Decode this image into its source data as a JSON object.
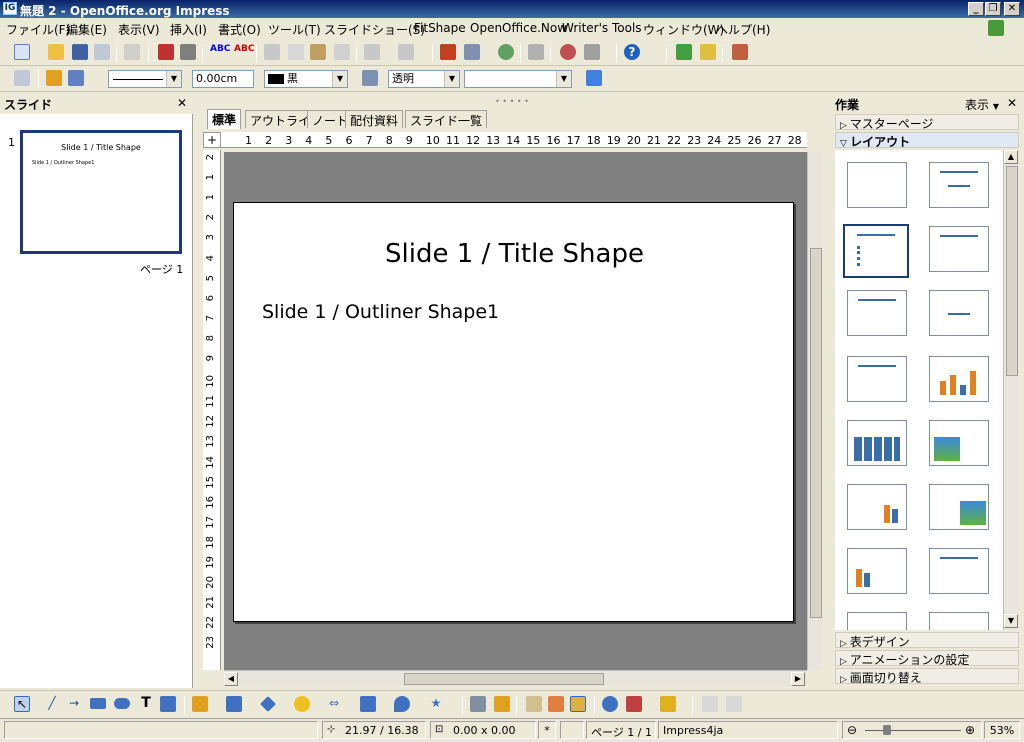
{
  "window": {
    "title": "無題 2 - OpenOffice.org Impress",
    "app_icon": "impress-icon"
  },
  "menubar": [
    "ファイル(F)",
    "編集(E)",
    "表示(V)",
    "挿入(I)",
    "書式(O)",
    "ツール(T)",
    "スライドショー(S)",
    "FitShape",
    "OpenOffice.Now",
    "Writer's Tools",
    "ウィンドウ(W)",
    "ヘルプ(H)"
  ],
  "format_bar": {
    "line_width": "0.00cm",
    "line_color": "黒",
    "area_style": "透明",
    "area_fill": ""
  },
  "slides_panel": {
    "title": "スライド",
    "thumbnail": {
      "number": "1",
      "title": "Slide 1 / Title Shape",
      "body": "Slide 1 / Outliner Shape1",
      "page_label": "ページ 1"
    }
  },
  "view_tabs": [
    "標準",
    "アウトライン",
    "ノート",
    "配付資料",
    "スライド一覧"
  ],
  "ruler": {
    "horizontal": [
      "1",
      "2",
      "3",
      "4",
      "5",
      "6",
      "7",
      "8",
      "9",
      "10",
      "11",
      "12",
      "13",
      "14",
      "15",
      "16",
      "17",
      "18",
      "19",
      "20",
      "21",
      "22",
      "23",
      "24",
      "25",
      "26",
      "27",
      "28"
    ],
    "vertical": [
      "2",
      "1",
      "1",
      "2",
      "3",
      "4",
      "5",
      "6",
      "7",
      "8",
      "9",
      "10",
      "11",
      "12",
      "13",
      "14",
      "15",
      "16",
      "17",
      "18",
      "19",
      "20",
      "21",
      "22",
      "23"
    ]
  },
  "slide": {
    "title": "Slide 1 / Title Shape",
    "body": "Slide 1 / Outliner Shape1"
  },
  "tasks_panel": {
    "title": "作業",
    "view_label": "表示",
    "sections": {
      "master": "マスターページ",
      "layout": "レイアウト",
      "table": "表デザイン",
      "animation": "アニメーションの設定",
      "transition": "画面切り替え"
    }
  },
  "statusbar": {
    "position": "21.97 / 16.38",
    "size": "0.00 x 0.00",
    "modified": "*",
    "page": "ページ 1 / 1",
    "master": "Impress4ja",
    "zoom": "53%"
  },
  "colors": {
    "title_bar": "#0a246a",
    "accent": "#3a6ea5"
  }
}
